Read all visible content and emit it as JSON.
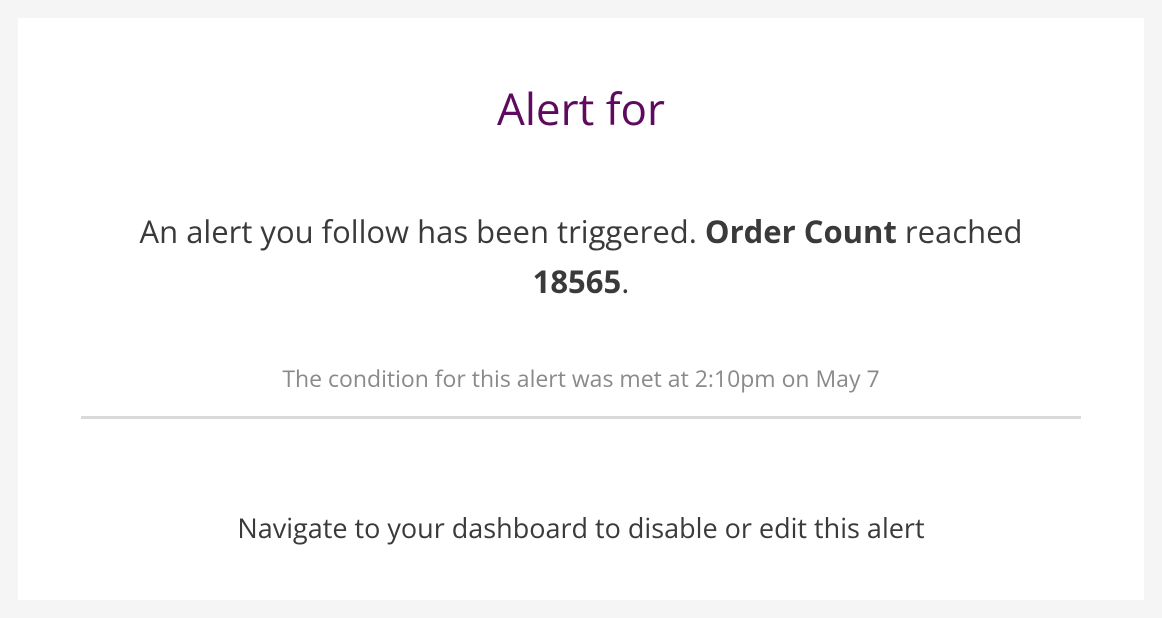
{
  "title": "Alert for",
  "body": {
    "intro": "An alert you follow has been triggered. ",
    "metric": "Order Count",
    "reached_word": " reached ",
    "value": "18565",
    "period": "."
  },
  "condition": "The condition for this alert was met at 2:10pm on May 7",
  "footer": "Navigate to your dashboard to disable or edit this alert"
}
